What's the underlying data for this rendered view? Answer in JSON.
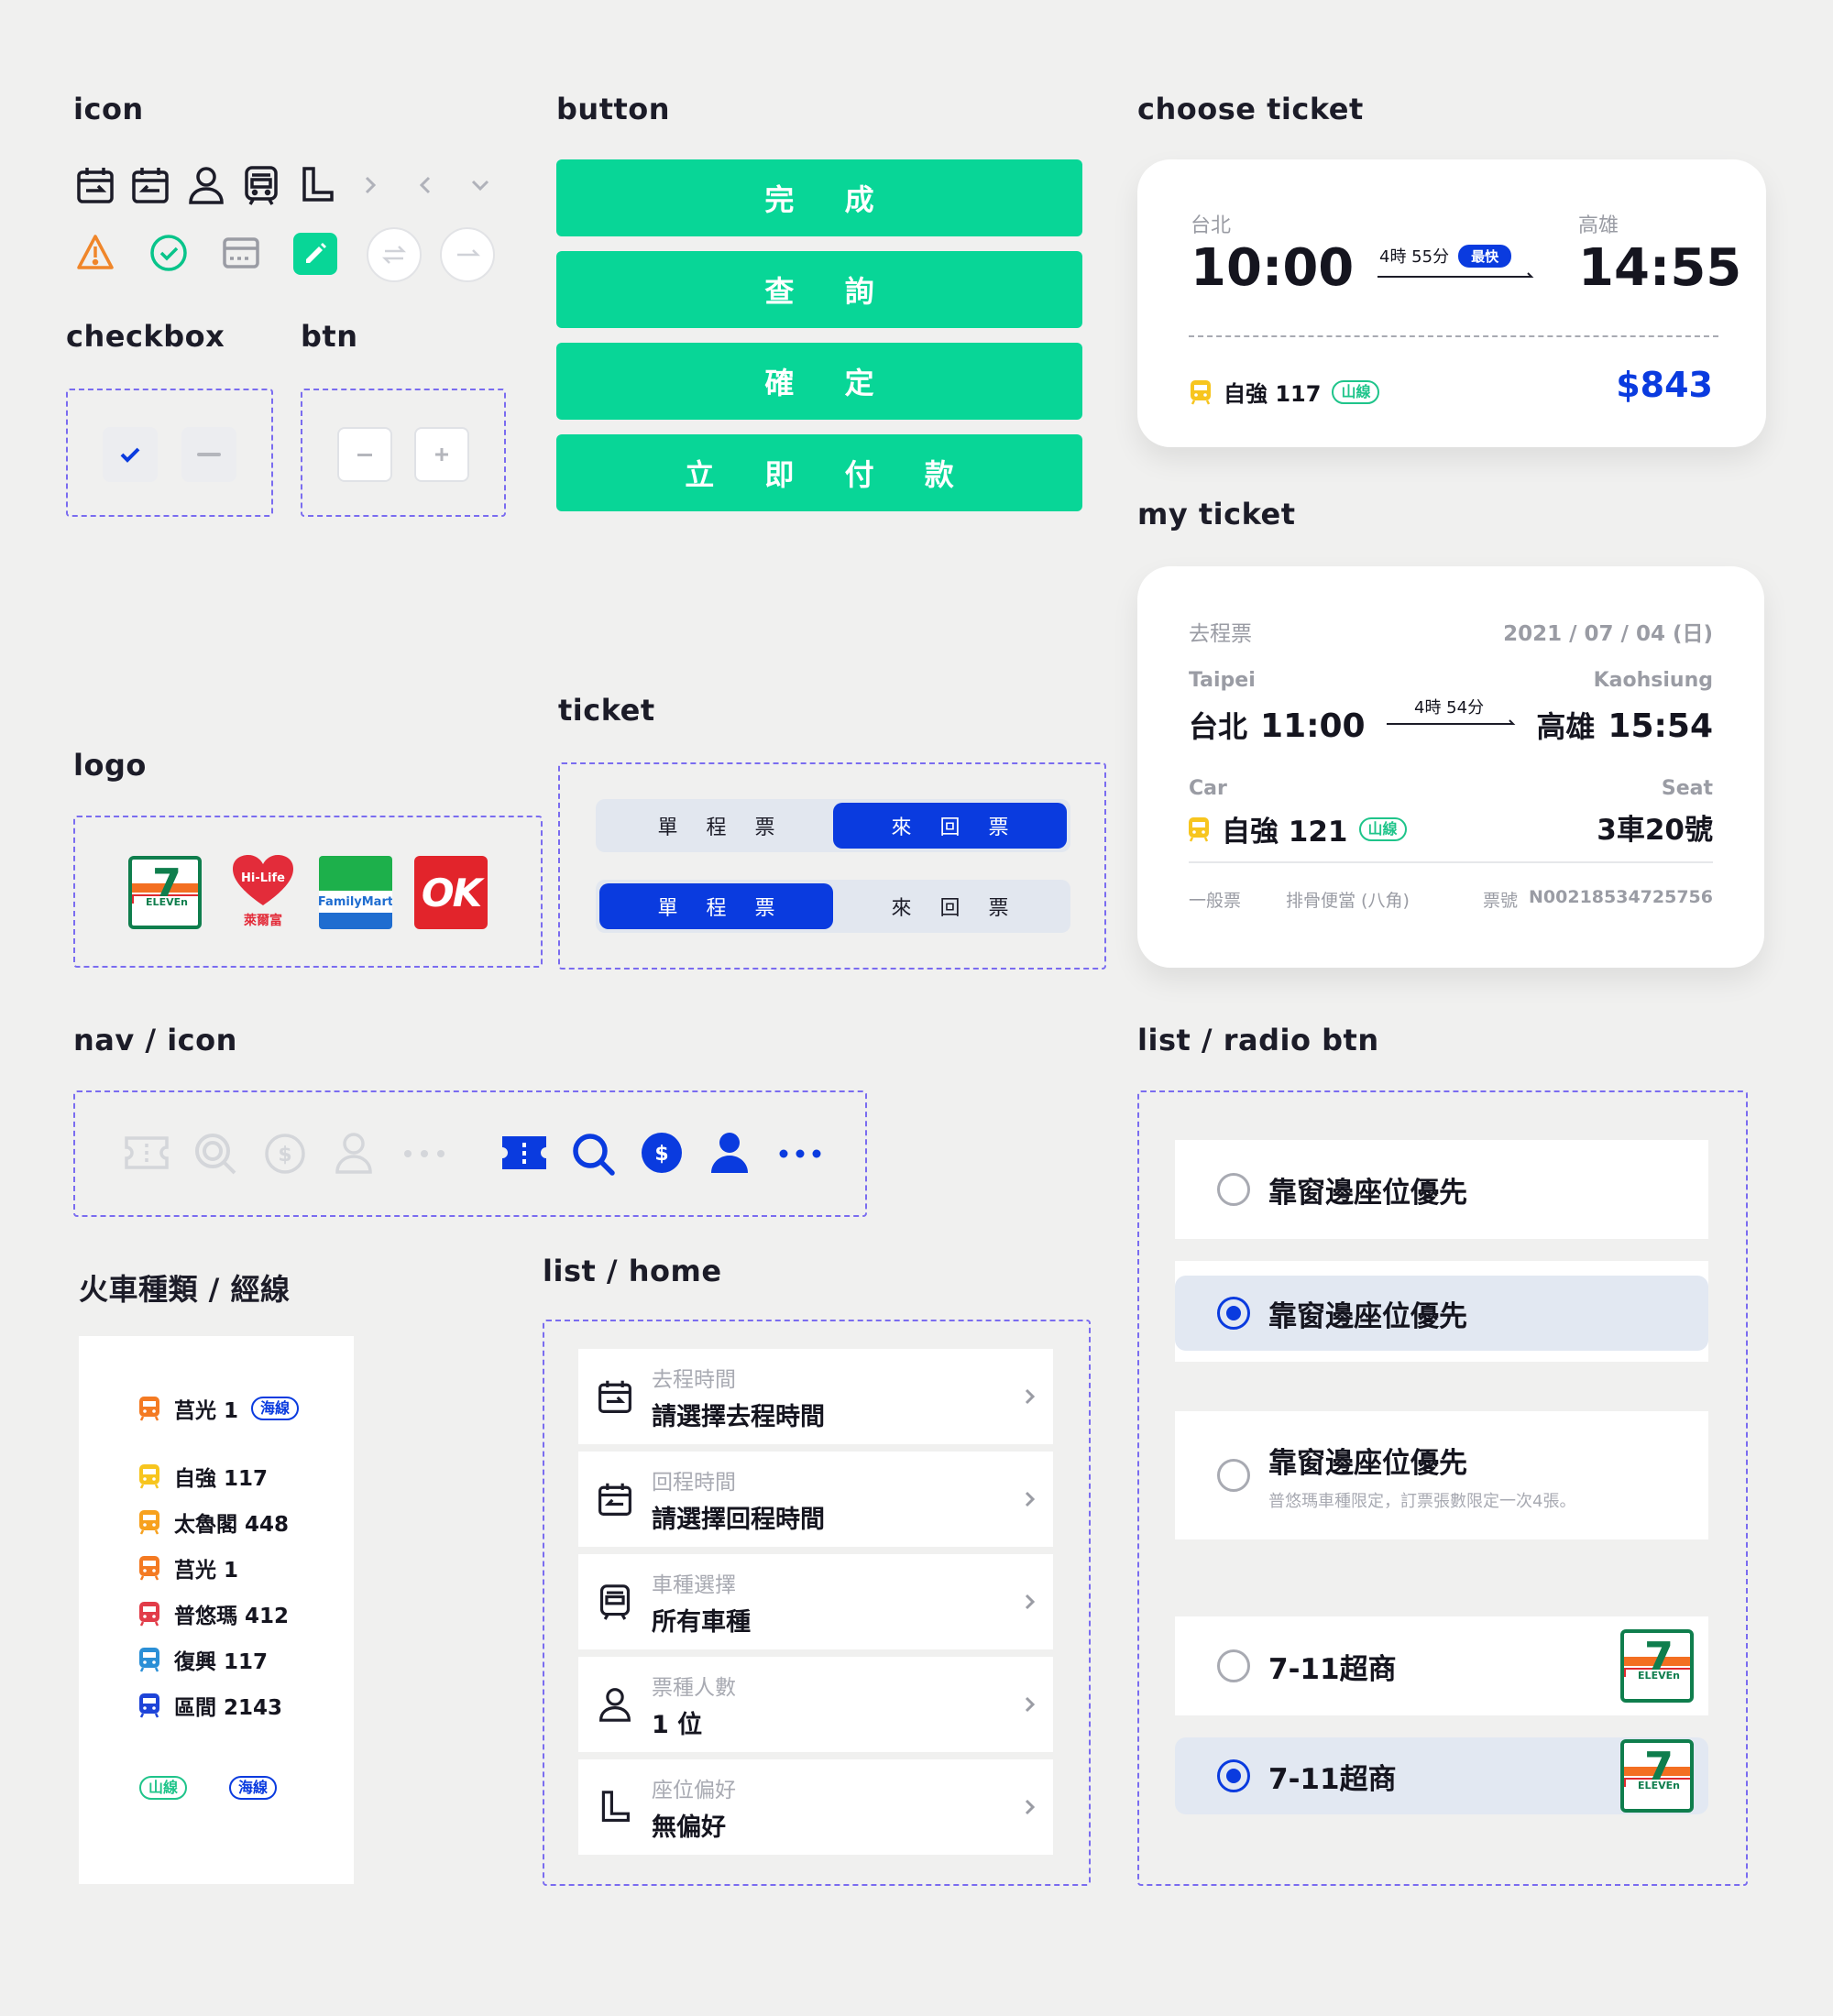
{
  "sections": {
    "icon": "icon",
    "button": "button",
    "choose_ticket": "choose ticket",
    "checkbox": "checkbox",
    "btn": "btn",
    "my_ticket": "my ticket",
    "ticket": "ticket",
    "logo": "logo",
    "nav_icon": "nav / icon",
    "list_radio": "list / radio btn",
    "train_type": "火車種類 / 經線",
    "list_home": "list / home"
  },
  "buttons": [
    "完 成",
    "查 詢",
    "確 定",
    "立 即 付 款"
  ],
  "choose_ticket": {
    "from_station": "台北",
    "from_time": "10:00",
    "duration": "4時 55分",
    "fastest_badge": "最快",
    "to_station": "高雄",
    "to_time": "14:55",
    "train": "自強 117",
    "line_badge": "山線",
    "price": "$843"
  },
  "my_ticket": {
    "type": "去程票",
    "date": "2021 / 07 / 04 (日)",
    "from_en": "Taipei",
    "to_en": "Kaohsiung",
    "from": "台北",
    "from_time": "11:00",
    "duration": "4時 54分",
    "to": "高雄",
    "to_time": "15:54",
    "car_label": "Car",
    "seat_label": "Seat",
    "train": "自強 121",
    "line_badge": "山線",
    "seat": "3車20號",
    "fare_type": "一般票",
    "meal": "排骨便當 (八角)",
    "ticket_no_label": "票號",
    "ticket_no": "N00218534725756"
  },
  "segmented": {
    "single": "單 程 票",
    "round": "來 回 票"
  },
  "logos": {
    "seven": "ELEVEn",
    "hilife": "Hi-Life",
    "hilife_cn": "萊爾富",
    "family": "FamilyMart",
    "ok": "OK"
  },
  "trains": [
    {
      "name": "莒光 1",
      "color": "#f47a22",
      "badge": "海線"
    },
    {
      "name": "自強 117",
      "color": "#f7c51e"
    },
    {
      "name": "太魯閣 448",
      "color": "#f7a11e"
    },
    {
      "name": "莒光 1",
      "color": "#f47a22"
    },
    {
      "name": "普悠瑪 412",
      "color": "#e23c49"
    },
    {
      "name": "復興 117",
      "color": "#2a8fd6"
    },
    {
      "name": "區間 2143",
      "color": "#1e44d8"
    }
  ],
  "train_badges": {
    "mountain": "山線",
    "sea": "海線"
  },
  "list_home": [
    {
      "label": "去程時間",
      "value": "請選擇去程時間",
      "icon": "calendar-out-icon"
    },
    {
      "label": "回程時間",
      "value": "請選擇回程時間",
      "icon": "calendar-return-icon"
    },
    {
      "label": "車種選擇",
      "value": "所有車種",
      "icon": "train-icon"
    },
    {
      "label": "票種人數",
      "value": "1 位",
      "icon": "person-icon"
    },
    {
      "label": "座位偏好",
      "value": "無偏好",
      "icon": "seat-icon"
    }
  ],
  "radio_list": {
    "window_seat": "靠窗邊座位優先",
    "window_seat_note": "普悠瑪車種限定，訂票張數限定一次4張。",
    "store": "7-11超商"
  },
  "colors": {
    "green": "#08d697",
    "blue": "#0a3bdf",
    "dash": "#7a6cf0"
  }
}
